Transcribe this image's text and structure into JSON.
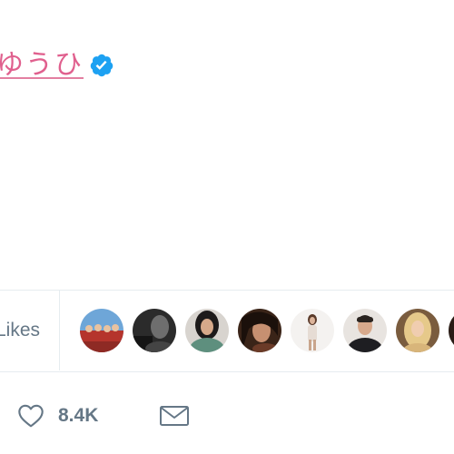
{
  "tweet": {
    "author_name": "ゆうひ",
    "verified_icon": "verified-badge-icon"
  },
  "likers": {
    "label": "Likes",
    "avatars": [
      {
        "name": "avatar-1"
      },
      {
        "name": "avatar-2"
      },
      {
        "name": "avatar-3"
      },
      {
        "name": "avatar-4"
      },
      {
        "name": "avatar-5"
      },
      {
        "name": "avatar-6"
      },
      {
        "name": "avatar-7"
      },
      {
        "name": "avatar-8"
      }
    ]
  },
  "actions": {
    "like_icon": "heart-icon",
    "like_count": "8.4K",
    "dm_icon": "envelope-icon"
  },
  "colors": {
    "author_pink": "#e0608e",
    "verified_blue": "#1da1f2",
    "muted_gray": "#657786",
    "divider": "#e6ecf0"
  }
}
